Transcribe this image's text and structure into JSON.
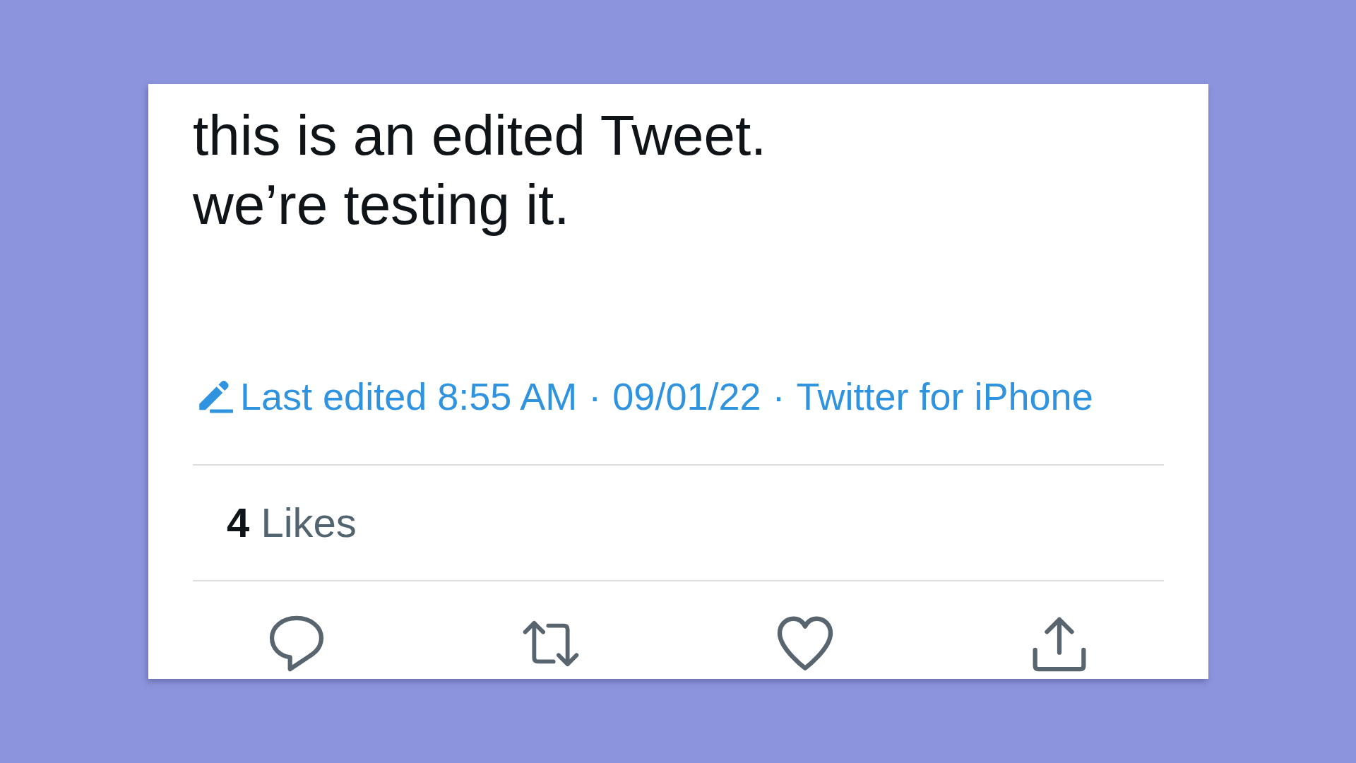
{
  "tweet": {
    "text": "this is an edited Tweet.\nwe’re testing it.",
    "edited": true,
    "meta": [
      {
        "kind": "timestamp",
        "text": "Last edited 8:55 AM"
      },
      {
        "kind": "separator",
        "text": "·"
      },
      {
        "kind": "date",
        "text": "09/01/22"
      },
      {
        "kind": "separator",
        "text": "·"
      },
      {
        "kind": "source",
        "text": "Twitter for iPhone"
      }
    ],
    "stats": [
      {
        "count": "4",
        "label": "Likes"
      }
    ],
    "actions": [
      {
        "kind": "reply"
      },
      {
        "kind": "retweet"
      },
      {
        "kind": "like"
      },
      {
        "kind": "share"
      }
    ]
  }
}
